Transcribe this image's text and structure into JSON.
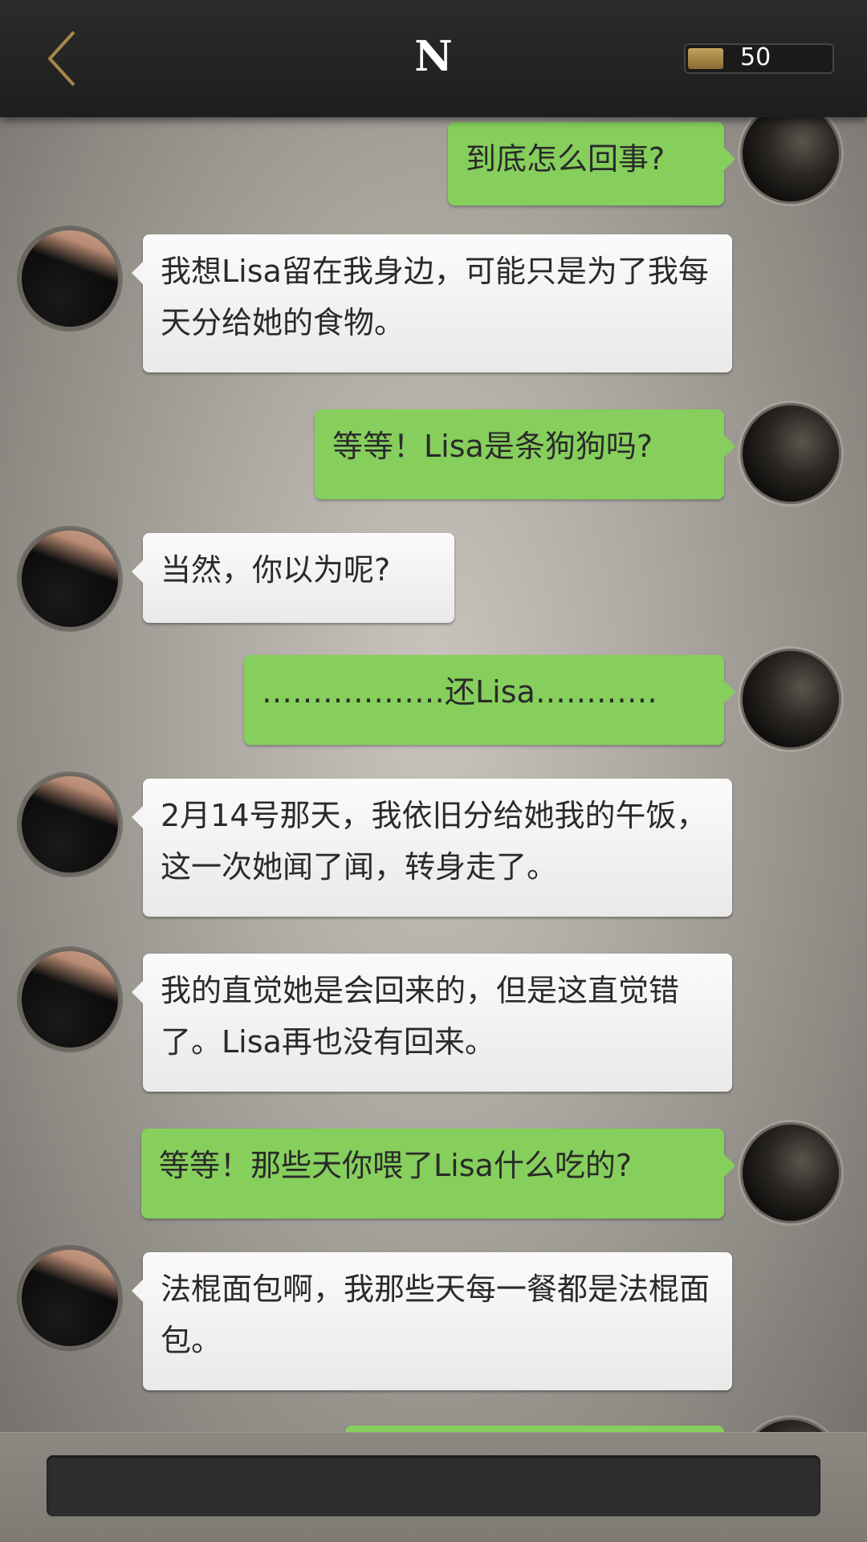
{
  "header": {
    "title": "N",
    "coins": "50"
  },
  "messages": [
    {
      "side": "right",
      "text": "到底怎么回事?"
    },
    {
      "side": "left",
      "text": "我想Lisa留在我身边，可能只是为了我每天分给她的食物。"
    },
    {
      "side": "right",
      "text": "等等！Lisa是条狗狗吗?"
    },
    {
      "side": "left",
      "text": "当然，你以为呢?"
    },
    {
      "side": "right",
      "text": "………………还Lisa…………"
    },
    {
      "side": "left",
      "text": "2月14号那天，我依旧分给她我的午饭，这一次她闻了闻，转身走了。"
    },
    {
      "side": "left",
      "text": "我的直觉她是会回来的，但是这直觉错了。Lisa再也没有回来。"
    },
    {
      "side": "right",
      "text": "等等！那些天你喂了Lisa什么吃的?"
    },
    {
      "side": "left",
      "text": "法棍面包啊，我那些天每一餐都是法棍面包。"
    }
  ],
  "colors": {
    "green_bubble": "#86cf5c",
    "white_bubble": "#f4f4f4",
    "topbar": "#232323"
  },
  "icons": {
    "back": "chevron-left-icon",
    "coin": "coin-bar-icon"
  }
}
